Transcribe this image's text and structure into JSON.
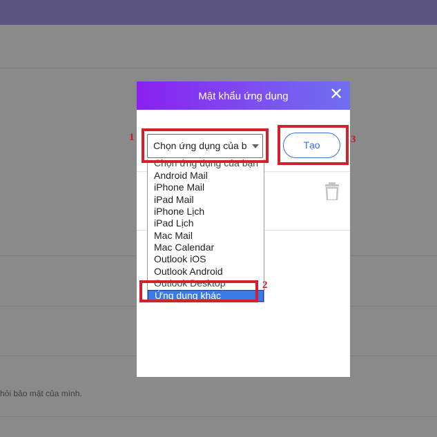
{
  "background_page": {
    "hint_text": "hỏi bảo mật của mình."
  },
  "dialog": {
    "title": "Mật khẩu ứng dụng",
    "close_icon": "close-icon",
    "select": {
      "value": "Chọn ứng dụng của b",
      "icon": "chevron-down-icon"
    },
    "create_button_label": "Tạo",
    "trash_icon": "trash-icon",
    "dropdown": {
      "options": [
        "Chọn ứng dụng của bạn",
        "Android Mail",
        "iPhone Mail",
        "iPad Mail",
        "iPhone Lịch",
        "iPad Lịch",
        "Mac Mail",
        "Mac Calendar",
        "Outlook iOS",
        "Outlook Android",
        "Outlook Desktop"
      ],
      "selected": "Ứng dụng khác"
    }
  },
  "annotations": {
    "num1": "1",
    "num2": "2",
    "num3": "3",
    "color": "#d3202a"
  },
  "colors": {
    "header_gradient_start": "#8a20f2",
    "header_gradient_end": "#6f6ff0",
    "accent": "#3a6fd8",
    "selected_option": "#3a7ae8"
  }
}
